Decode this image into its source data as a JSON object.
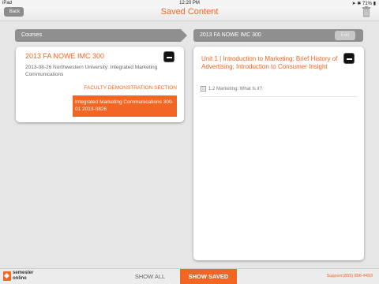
{
  "status_bar": {
    "carrier": "iPad",
    "time": "12:20 PM",
    "battery": "71%"
  },
  "nav": {
    "back_label": "Back",
    "title": "Saved Content"
  },
  "left_panel": {
    "header": "Courses",
    "course": {
      "title": "2013 FA NOWE IMC 300",
      "meta": "2013-08-26 Northwestern University: Integrated Marketing Communications",
      "faculty_label": "FACULTY DEMONSTRATION SECTION",
      "section": "Integrated Marketing Communications 300-01 2013-0826"
    }
  },
  "right_panel": {
    "header": "2013 FA NOWE IMC 300",
    "edit_label": "Edit",
    "unit": {
      "title": "Unit 1 | Introduction to Marketing: Brief History of Advertising; Introduction to Consumer Insight",
      "lesson": "1.2 Marketing: What Is it?"
    }
  },
  "bottom": {
    "logo_line1": "semester",
    "logo_line2": "online",
    "tab_all": "SHOW ALL",
    "tab_saved": "SHOW SAVED",
    "support": "Support:(855) 896-4493"
  },
  "colors": {
    "accent": "#f26522",
    "panel_header": "#8f8f8f"
  }
}
